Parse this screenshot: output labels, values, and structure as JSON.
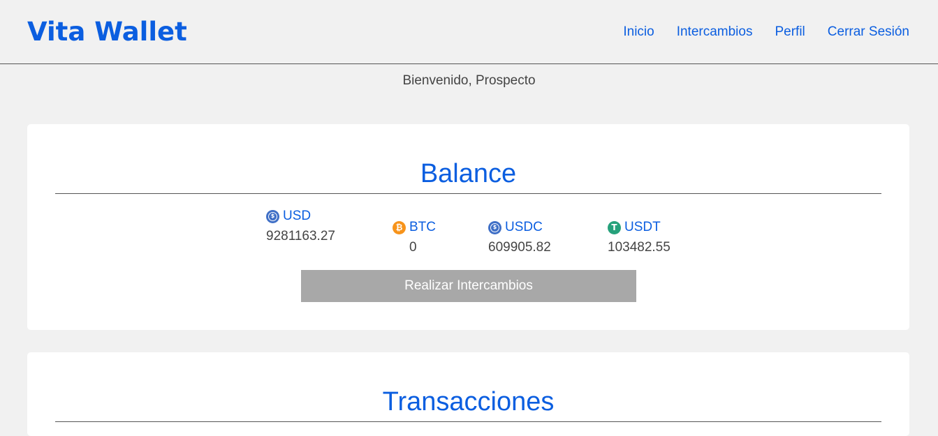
{
  "app": {
    "logo": "Vita Wallet"
  },
  "nav": {
    "items": [
      "Inicio",
      "Intercambios",
      "Perfil",
      "Cerrar Sesión"
    ]
  },
  "welcome": "Bienvenido, Prospecto",
  "balance": {
    "title": "Balance",
    "currencies": [
      {
        "code": "USD",
        "value": "9281163.27",
        "icon": "usd-coin-icon"
      },
      {
        "code": "BTC",
        "value": "0",
        "icon": "bitcoin-icon"
      },
      {
        "code": "USDC",
        "value": "609905.82",
        "icon": "usdc-icon"
      },
      {
        "code": "USDT",
        "value": "103482.55",
        "icon": "tether-icon"
      }
    ],
    "action_label": "Realizar Intercambios"
  },
  "transactions": {
    "title": "Transacciones"
  },
  "colors": {
    "accent": "#0b5ee0",
    "background": "#f1f1f1",
    "button_disabled": "#a8a8a8",
    "btc": "#f7931a",
    "usdt": "#26a17b",
    "usd": "#3f6fc6"
  }
}
